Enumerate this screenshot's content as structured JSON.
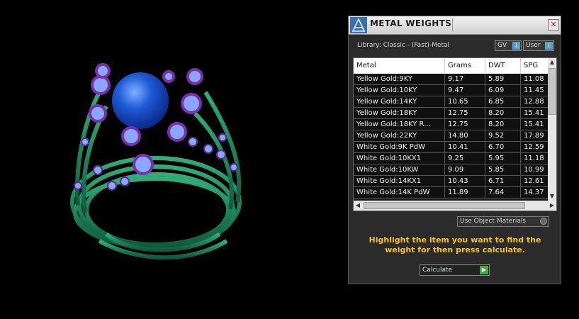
{
  "panel": {
    "title": "METAL WEIGHTS",
    "close_glyph": "✕",
    "library_label": "Library: Classic - (Fast)-Metal",
    "toggles": [
      {
        "label": "GV",
        "glyph": "i"
      },
      {
        "label": "User",
        "glyph": "i"
      }
    ],
    "columns": [
      "Metal",
      "Grams",
      "DWT",
      "SPG"
    ],
    "rows": [
      [
        "Yellow Gold:9KY",
        "9.17",
        "5.89",
        "11.08"
      ],
      [
        "Yellow Gold:10KY",
        "9.47",
        "6.09",
        "11.45"
      ],
      [
        "Yellow Gold:14KY",
        "10.65",
        "6.85",
        "12.88"
      ],
      [
        "Yellow Gold:18KY",
        "12.75",
        "8.20",
        "15.41"
      ],
      [
        "Yellow Gold:18KY R...",
        "12.75",
        "8.20",
        "15.41"
      ],
      [
        "Yellow Gold:22KY",
        "14.80",
        "9.52",
        "17.89"
      ],
      [
        "White Gold:9K PdW",
        "10.41",
        "6.70",
        "12.59"
      ],
      [
        "White Gold:10KX1",
        "9.25",
        "5.95",
        "11.18"
      ],
      [
        "White Gold:10KW",
        "9.09",
        "5.85",
        "10.99"
      ],
      [
        "White Gold:14KX1",
        "10.43",
        "6.71",
        "12.61"
      ],
      [
        "White Gold:14K PdW",
        "11.89",
        "7.64",
        "14.37"
      ]
    ],
    "use_object_materials": "Use Object Materials",
    "instruction": "Highlight the item you want to find the weight for then press calculate.",
    "calculate_label": "Calculate",
    "scroll_up": "▲",
    "scroll_down": "▼",
    "scroll_left": "◀",
    "scroll_right": "▶",
    "play_glyph": "▶"
  },
  "colors": {
    "ring_band": "#1f8a63",
    "gem_center": "#1e5fd4",
    "bezel": "#7b2fa8",
    "stone": "#8aa7ff",
    "instruction_text": "#f2c230"
  }
}
